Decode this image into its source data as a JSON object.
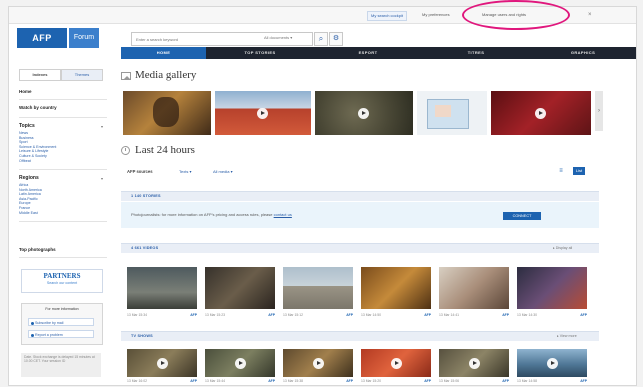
{
  "topbar": {
    "items": [
      "My search cockpit",
      "My preferences",
      "Manage users and rights"
    ],
    "close": "×"
  },
  "header": {
    "logo": "AFP",
    "logo_suffix": "Forum",
    "search_placeholder": "Enter a search keyword",
    "search_scope": "All documents ▾",
    "nav": [
      "HOME",
      "TOP STORIES",
      "ESPORT",
      "TITRES",
      "GRAPHICS"
    ]
  },
  "sidebar": {
    "tabs": [
      "Indexes",
      "Themes"
    ],
    "home": "Home",
    "watch": "Watch by country",
    "topics_title": "Topics",
    "topics": [
      "News",
      "Business",
      "Sport",
      "Science & Environment",
      "Leisure & Lifestyle",
      "Culture & Society",
      "Offbeat"
    ],
    "regions_title": "Regions",
    "regions": [
      "Africa",
      "North America",
      "Latin America",
      "Asia-Pacific",
      "Europe",
      "France",
      "Middle East"
    ],
    "top_photo": "Top photographs",
    "partners_title": "PARTNERS",
    "partners_sub": "Search our content",
    "invest_title": "For more information",
    "invest_btns": [
      "Subscribe by mail",
      "Report a problem"
    ],
    "footer": "Date. Stock exchange is delayed 15 minutes at 10.00 CET. Your session ID"
  },
  "main": {
    "gallery_title": "Media gallery",
    "last24_title": "Last 24 hours",
    "filter_label": "AFP sources",
    "filter_dropdowns": [
      "Texts ▾",
      "All media ▾"
    ],
    "view_toggle": "List",
    "band_sources": "1 140 STORIES",
    "notice_text": "Photojournalists: for more information on AFP's pricing and access rules, please ",
    "notice_link": "contact us",
    "notice_button": "CONNECT",
    "band_video": "4 661 VIDEOS",
    "band_video_right": "▸  Display all",
    "band_tv": "TV SHOWS",
    "band_tv_right": "▸  View more",
    "video_meta": [
      "13 Mar 15:34",
      "13 Mar 15:23",
      "13 Mar 15:12",
      "13 Mar 14:50",
      "13 Mar 14:41",
      "13 Mar 14:30"
    ],
    "video_source": "AFP",
    "tv_meta": [
      "13 Mar 16:02",
      "13 Mar 15:44",
      "13 Mar 15:38",
      "13 Mar 15:20",
      "13 Mar 15:06",
      "13 Mar 14:58"
    ]
  },
  "colors": {
    "brand": "#1d63b0",
    "nav_bg": "#1e2430",
    "highlight_ring": "#e0177d"
  }
}
